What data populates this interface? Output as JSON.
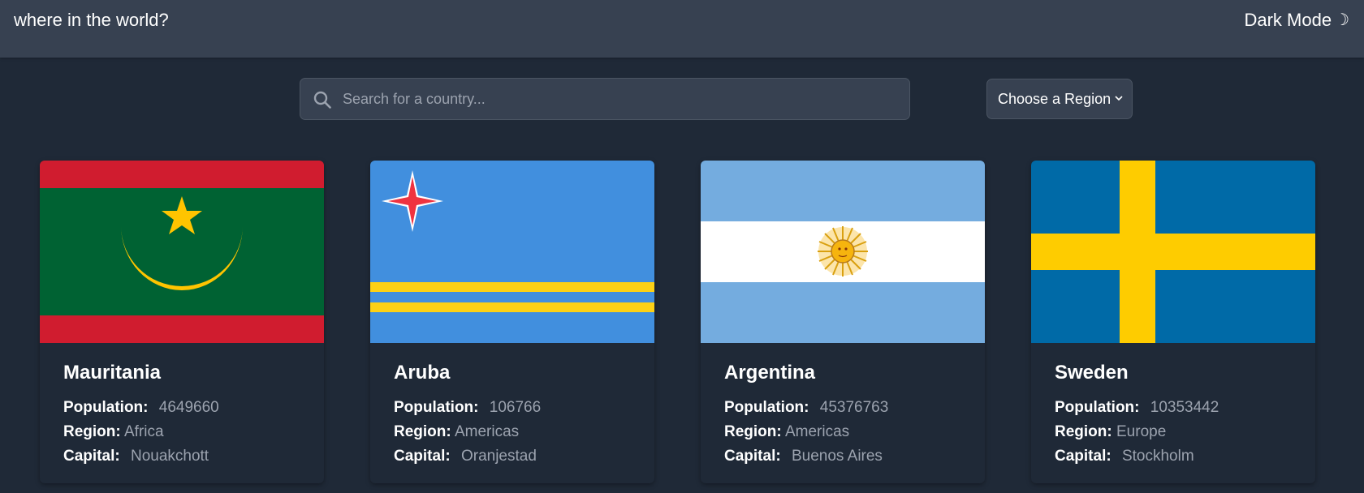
{
  "header": {
    "title": "where in the world?",
    "mode_label": "Dark Mode",
    "mode_icon": "☽"
  },
  "search": {
    "placeholder": "Search for a country...",
    "value": ""
  },
  "filter": {
    "selected": "Choose a Region"
  },
  "labels": {
    "population": "Population:",
    "region": "Region:",
    "capital": "Capital:"
  },
  "countries": [
    {
      "name": "Mauritania",
      "population": "4649660",
      "region": "Africa",
      "capital": "Nouakchott",
      "flag_icon": "mauritania-flag"
    },
    {
      "name": "Aruba",
      "population": "106766",
      "region": "Americas",
      "capital": "Oranjestad",
      "flag_icon": "aruba-flag"
    },
    {
      "name": "Argentina",
      "population": "45376763",
      "region": "Americas",
      "capital": "Buenos Aires",
      "flag_icon": "argentina-flag"
    },
    {
      "name": "Sweden",
      "population": "10353442",
      "region": "Europe",
      "capital": "Stockholm",
      "flag_icon": "sweden-flag"
    }
  ],
  "colors": {
    "background": "#1f2937",
    "header": "#374151",
    "muted_text": "#9ca3af"
  }
}
